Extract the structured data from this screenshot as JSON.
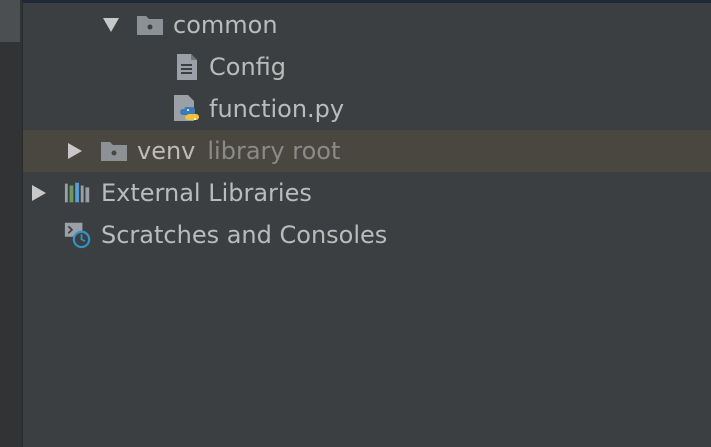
{
  "project_tree": {
    "items": [
      {
        "label": "common",
        "icon": "folder-icon",
        "expanded": true
      },
      {
        "label": "Config",
        "icon": "text-file-icon"
      },
      {
        "label": "function.py",
        "icon": "python-file-icon"
      },
      {
        "label": "venv",
        "hint": "library root",
        "icon": "folder-icon",
        "expanded": false,
        "selected": true
      },
      {
        "label": "External Libraries",
        "icon": "library-icon",
        "expanded": false
      },
      {
        "label": "Scratches and Consoles",
        "icon": "scratches-icon"
      }
    ]
  },
  "colors": {
    "background": "#3c3f41",
    "selected_row": "#4a4740",
    "text": "#bbbbbb",
    "hint_text": "#8a8a8a",
    "python_blue": "#3d7ab8",
    "python_yellow": "#f0c43a",
    "library_green": "#6a9d5b",
    "library_blue": "#5a9ed6",
    "clock_blue": "#3592c4"
  }
}
